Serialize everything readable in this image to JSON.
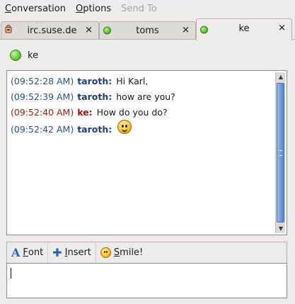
{
  "menu": [
    {
      "label": "Conversation",
      "mnemonic": "C",
      "rest": "onversation",
      "enabled": true
    },
    {
      "label": "Options",
      "mnemonic": "O",
      "rest": "ptions",
      "enabled": true
    },
    {
      "label": "Send To",
      "mnemonic": "",
      "rest": "Send To",
      "enabled": false
    }
  ],
  "tabs": [
    {
      "label": "irc.suse.de",
      "icon": "irc-chat-icon",
      "active": false
    },
    {
      "label": "toms",
      "icon": "available-status-icon",
      "active": false
    },
    {
      "label": "ke",
      "icon": "available-status-icon",
      "active": true
    }
  ],
  "close_glyph": "✕",
  "header": {
    "buddy": "ke",
    "status_color": "#62c33a"
  },
  "messages": [
    {
      "time": "(09:52:28 AM)",
      "nick": "taroth:",
      "text": "Hi Karl,",
      "self": true
    },
    {
      "time": "(09:52:39 AM)",
      "nick": "taroth:",
      "text": "how are you?",
      "self": true
    },
    {
      "time": "(09:52:40 AM)",
      "nick": "ke:",
      "text": "How do you do?",
      "self": false
    },
    {
      "time": "(09:52:42 AM)",
      "nick": "taroth:",
      "text": "",
      "self": true,
      "emoticon": "smiley-icon"
    }
  ],
  "toolbar": {
    "font": {
      "mnemonic": "F",
      "rest": "ont",
      "label": "Font"
    },
    "insert": {
      "mnemonic": "I",
      "rest": "nsert",
      "label": "Insert"
    },
    "smile": {
      "mnemonic": "S",
      "rest": "mile!",
      "label": "Smile!"
    }
  },
  "colors": {
    "self_nick": "#1e3f78",
    "other_nick": "#a81212",
    "scroll_thumb": "#6b97d6"
  }
}
